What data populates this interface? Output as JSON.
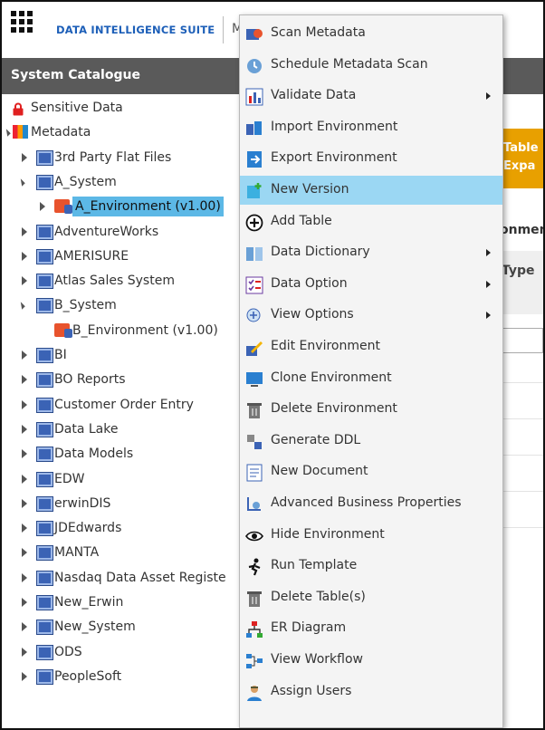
{
  "header": {
    "app_title": "DATA INTELLIGENCE SUITE",
    "truncated_menu": "M"
  },
  "sidebar": {
    "title": "System Catalogue",
    "tree": [
      {
        "label": "Sensitive Data",
        "icon": "lock-icon",
        "level": 0,
        "toggle": "none"
      },
      {
        "label": "Metadata",
        "icon": "metadata-icon",
        "level": 0,
        "toggle": "expanded"
      },
      {
        "label": "3rd Party Flat Files",
        "icon": "system-icon",
        "level": 1,
        "toggle": "collapsed"
      },
      {
        "label": "A_System",
        "icon": "system-icon",
        "level": 1,
        "toggle": "expanded"
      },
      {
        "label": "A_Environment (v1.00)",
        "icon": "environment-icon",
        "level": 2,
        "toggle": "collapsed",
        "selected": true
      },
      {
        "label": "AdventureWorks",
        "icon": "system-icon",
        "level": 1,
        "toggle": "collapsed"
      },
      {
        "label": "AMERISURE",
        "icon": "system-icon",
        "level": 1,
        "toggle": "collapsed"
      },
      {
        "label": "Atlas Sales System",
        "icon": "system-icon",
        "level": 1,
        "toggle": "collapsed"
      },
      {
        "label": "B_System",
        "icon": "system-icon",
        "level": 1,
        "toggle": "expanded"
      },
      {
        "label": "B_Environment (v1.00)",
        "icon": "environment-icon",
        "level": 2,
        "toggle": "none"
      },
      {
        "label": "BI",
        "icon": "system-icon",
        "level": 1,
        "toggle": "collapsed"
      },
      {
        "label": "BO Reports",
        "icon": "system-icon",
        "level": 1,
        "toggle": "collapsed"
      },
      {
        "label": "Customer Order Entry",
        "icon": "system-icon",
        "level": 1,
        "toggle": "collapsed"
      },
      {
        "label": "Data Lake",
        "icon": "system-icon",
        "level": 1,
        "toggle": "collapsed"
      },
      {
        "label": "Data Models",
        "icon": "system-icon",
        "level": 1,
        "toggle": "collapsed"
      },
      {
        "label": "EDW",
        "icon": "system-icon",
        "level": 1,
        "toggle": "collapsed"
      },
      {
        "label": "erwinDIS",
        "icon": "system-icon",
        "level": 1,
        "toggle": "collapsed"
      },
      {
        "label": "JDEdwards",
        "icon": "system-icon",
        "level": 1,
        "toggle": "collapsed"
      },
      {
        "label": "MANTA",
        "icon": "system-icon",
        "level": 1,
        "toggle": "collapsed"
      },
      {
        "label": "Nasdaq Data Asset Registe",
        "icon": "system-icon",
        "level": 1,
        "toggle": "collapsed"
      },
      {
        "label": "New_Erwin",
        "icon": "system-icon",
        "level": 1,
        "toggle": "collapsed"
      },
      {
        "label": "New_System",
        "icon": "system-icon",
        "level": 1,
        "toggle": "collapsed"
      },
      {
        "label": "ODS",
        "icon": "system-icon",
        "level": 1,
        "toggle": "collapsed"
      },
      {
        "label": "PeopleSoft",
        "icon": "system-icon",
        "level": 1,
        "toggle": "collapsed"
      }
    ]
  },
  "background": {
    "card_line1": "Table",
    "card_line2": "Expa",
    "breadcrumb_fragment": "onmen",
    "column_fragment": "Type"
  },
  "context_menu": {
    "items": [
      {
        "label": "Scan Metadata",
        "icon": "scan-metadata-icon",
        "submenu": false
      },
      {
        "label": "Schedule Metadata Scan",
        "icon": "schedule-scan-icon",
        "submenu": false
      },
      {
        "label": "Validate Data",
        "icon": "validate-data-icon",
        "submenu": true
      },
      {
        "label": "Import Environment",
        "icon": "import-environment-icon",
        "submenu": false
      },
      {
        "label": "Export Environment",
        "icon": "export-environment-icon",
        "submenu": false
      },
      {
        "label": "New Version",
        "icon": "new-version-icon",
        "submenu": false,
        "highlighted": true
      },
      {
        "label": "Add Table",
        "icon": "add-table-icon",
        "submenu": false
      },
      {
        "label": "Data Dictionary",
        "icon": "data-dictionary-icon",
        "submenu": true
      },
      {
        "label": "Data Option",
        "icon": "data-option-icon",
        "submenu": true
      },
      {
        "label": "View Options",
        "icon": "view-options-icon",
        "submenu": true
      },
      {
        "label": "Edit Environment",
        "icon": "edit-environment-icon",
        "submenu": false
      },
      {
        "label": "Clone Environment",
        "icon": "clone-environment-icon",
        "submenu": false
      },
      {
        "label": "Delete Environment",
        "icon": "delete-environment-icon",
        "submenu": false
      },
      {
        "label": "Generate DDL",
        "icon": "generate-ddl-icon",
        "submenu": false
      },
      {
        "label": "New Document",
        "icon": "new-document-icon",
        "submenu": false
      },
      {
        "label": "Advanced Business Properties",
        "icon": "business-properties-icon",
        "submenu": false
      },
      {
        "label": "Hide Environment",
        "icon": "eye-icon",
        "submenu": false
      },
      {
        "label": "Run Template",
        "icon": "run-template-icon",
        "submenu": false
      },
      {
        "label": "Delete Table(s)",
        "icon": "delete-tables-icon",
        "submenu": false
      },
      {
        "label": "ER Diagram",
        "icon": "er-diagram-icon",
        "submenu": false
      },
      {
        "label": "View Workflow",
        "icon": "workflow-icon",
        "submenu": false
      },
      {
        "label": "Assign Users",
        "icon": "assign-users-icon",
        "submenu": false
      }
    ]
  },
  "colors": {
    "brand_blue": "#1d5fb8",
    "title_bar": "#5a5a5a",
    "selection": "#5cb8e6",
    "menu_highlight": "#9bd7f3",
    "accent_orange": "#e8a000"
  }
}
